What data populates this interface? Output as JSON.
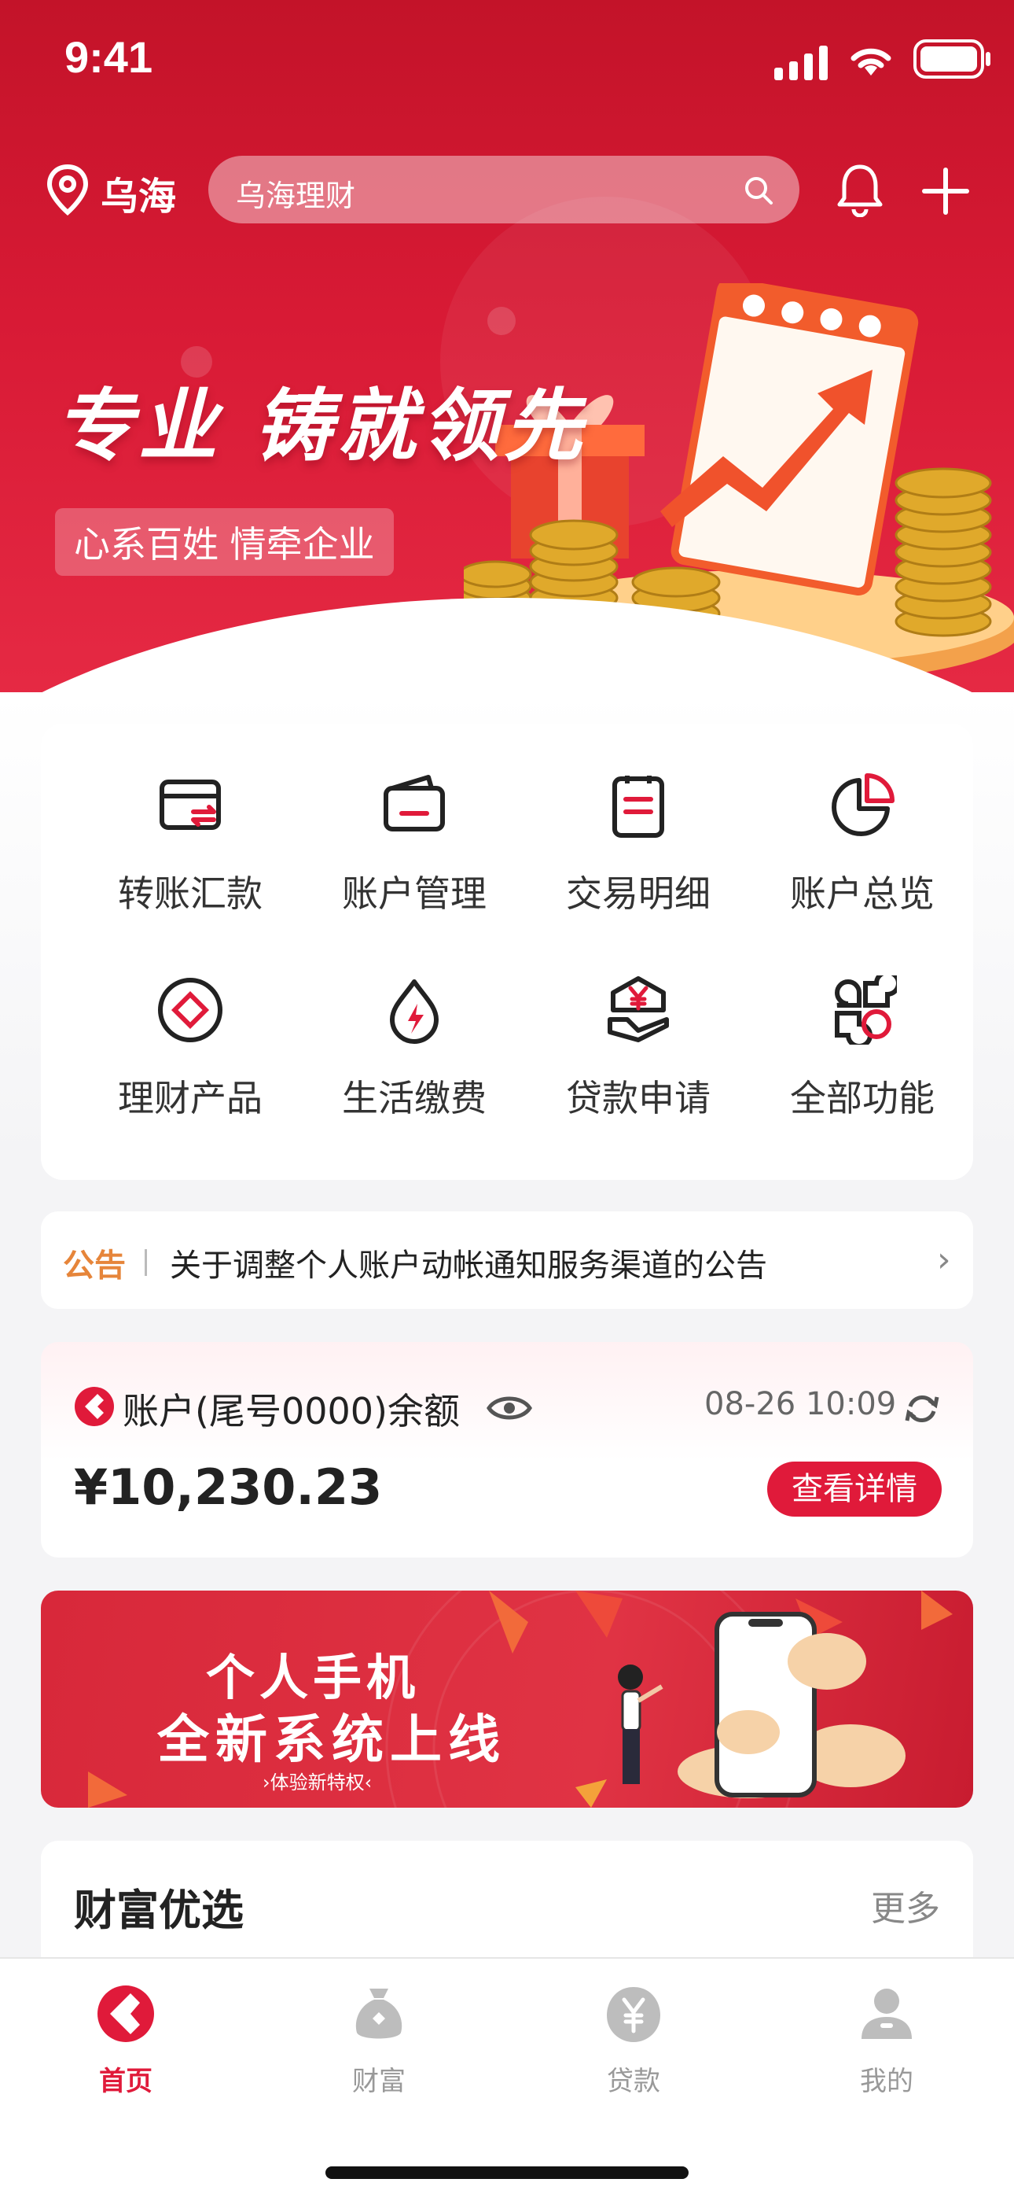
{
  "status_bar": {
    "time": "9:41"
  },
  "header": {
    "location": "乌海",
    "search_placeholder": "乌海理财",
    "icons": [
      "location-pin-icon",
      "search-icon",
      "bell-icon",
      "plus-icon"
    ]
  },
  "hero": {
    "slogan": "专业 铸就领先",
    "sub_slogan": "心系百姓 情牵企业"
  },
  "functions": [
    {
      "label": "转账汇款",
      "icon": "transfer-card-icon"
    },
    {
      "label": "账户管理",
      "icon": "wallet-icon"
    },
    {
      "label": "交易明细",
      "icon": "document-list-icon"
    },
    {
      "label": "账户总览",
      "icon": "pie-chart-icon"
    },
    {
      "label": "理财产品",
      "icon": "diamond-circle-icon"
    },
    {
      "label": "生活缴费",
      "icon": "flame-drop-icon"
    },
    {
      "label": "贷款申请",
      "icon": "yen-hand-icon"
    },
    {
      "label": "全部功能",
      "icon": "grid-apps-icon"
    }
  ],
  "notice": {
    "tag": "公告",
    "text": "关于调整个人账户动帐通知服务渠道的公告"
  },
  "balance": {
    "title": "账户(尾号0000)余额",
    "timestamp": "08-26 10:09",
    "amount": "¥10,230.23",
    "detail_button": "查看详情"
  },
  "promo": {
    "line1": "个人手机",
    "line2": "全新系统上线",
    "line3": "›体验新特权‹"
  },
  "wealth": {
    "title": "财富优选",
    "more": "更多"
  },
  "tabbar": {
    "items": [
      {
        "label": "首页",
        "active": true
      },
      {
        "label": "财富",
        "active": false
      },
      {
        "label": "贷款",
        "active": false
      },
      {
        "label": "我的",
        "active": false
      }
    ]
  },
  "colors": {
    "brand_red": "#e01a3a",
    "notice_orange": "#e6853a"
  }
}
